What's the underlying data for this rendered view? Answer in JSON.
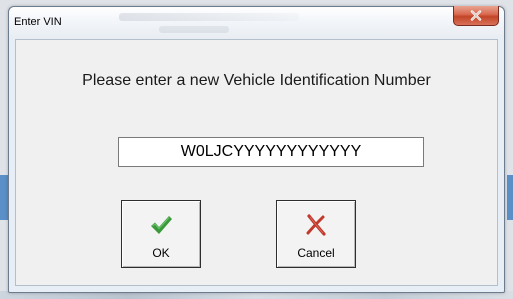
{
  "window": {
    "title": "Enter VIN",
    "close_icon": "close-x-icon"
  },
  "dialog": {
    "prompt": "Please enter a new Vehicle Identification Number",
    "vin_value": "W0LJCYYYYYYYYYYYY",
    "ok_label": "OK",
    "ok_icon": "green-checkmark-icon",
    "cancel_label": "Cancel",
    "cancel_icon": "red-x-icon"
  },
  "colors": {
    "checkmark": "#3a9a3a",
    "cancel_x": "#c0392b",
    "close_button": "#c8492c"
  }
}
